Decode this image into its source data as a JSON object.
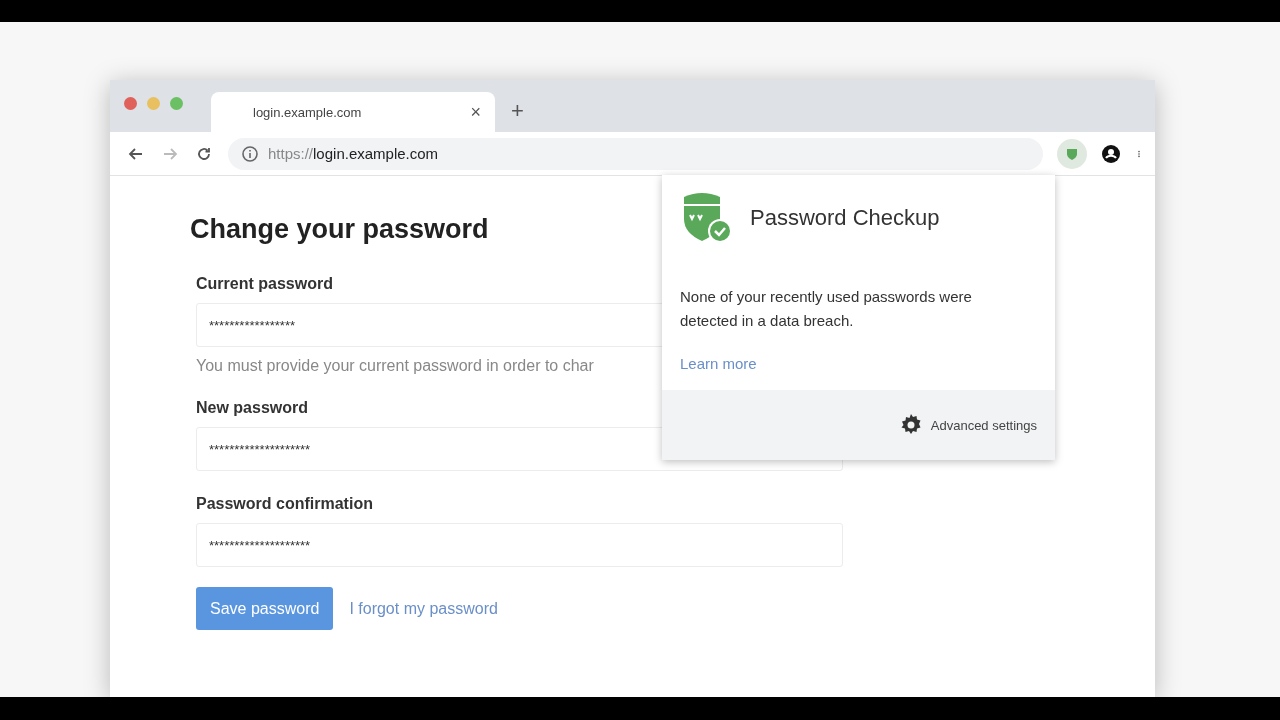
{
  "tab": {
    "title": "login.example.com",
    "close": "×",
    "new_tab": "+",
    "selected": true
  },
  "address": {
    "scheme": "https://",
    "host": "login.example.com"
  },
  "page": {
    "heading": "Change your password",
    "fields": [
      {
        "label": "Current password",
        "value": "*****************",
        "hint": "You must provide your current password in order to char"
      },
      {
        "label": "New password",
        "value": "********************"
      },
      {
        "label": "Password confirmation",
        "value": "********************"
      }
    ],
    "save_button": "Save password",
    "forgot_link": "I forgot my password"
  },
  "popup": {
    "title": "Password Checkup",
    "message": "None of your recently used passwords were detected in a data breach.",
    "learn_more": "Learn more",
    "settings": "Advanced settings"
  }
}
